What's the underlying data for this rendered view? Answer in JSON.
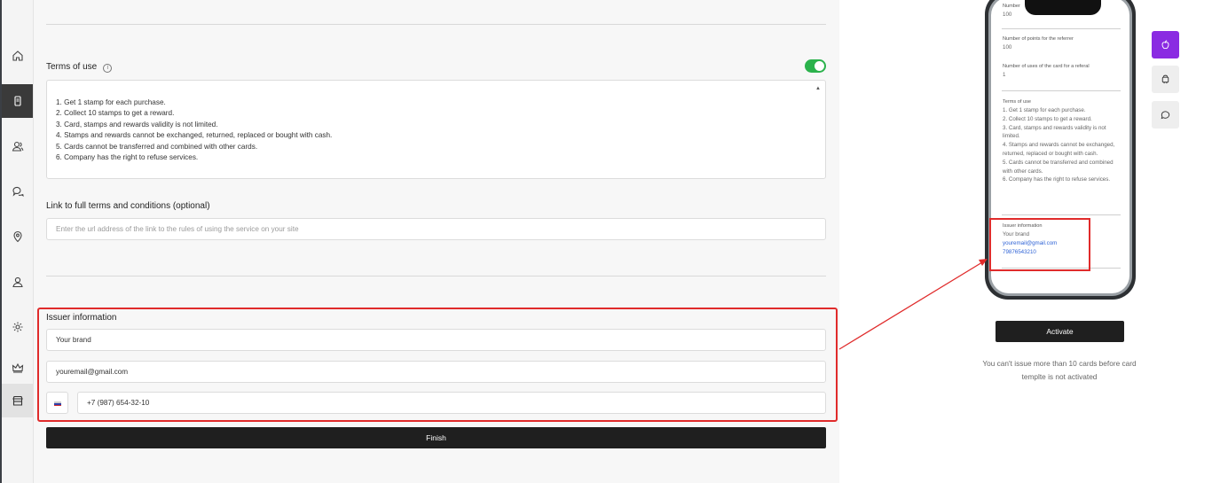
{
  "sidebar": {
    "items": [
      {
        "icon": "home-icon"
      },
      {
        "icon": "card-template-icon",
        "active": true
      },
      {
        "icon": "clients-icon"
      },
      {
        "icon": "messages-icon"
      },
      {
        "icon": "location-icon"
      },
      {
        "icon": "user-icon"
      },
      {
        "icon": "settings-icon"
      },
      {
        "icon": "crown-icon"
      },
      {
        "icon": "store-icon"
      }
    ]
  },
  "form": {
    "terms_label": "Terms of use",
    "terms_enabled": true,
    "terms_text": "1. Get 1 stamp for each purchase.\n2. Collect 10 stamps to get a reward.\n3. Card, stamps and rewards validity is not limited.\n4. Stamps and rewards cannot be exchanged, returned, replaced or bought with cash.\n5. Cards cannot be transferred and combined with other cards.\n6. Company has the right to refuse services.",
    "link_label": "Link to full terms and conditions (optional)",
    "link_placeholder": "Enter the url address of the link to the rules of using the service on your site",
    "issuer_label": "Issuer information",
    "brand_value": "Your brand",
    "email_value": "youremail@gmail.com",
    "phone_value": "+7 (987) 654-32-10",
    "finish_label": "Finish"
  },
  "preview": {
    "phone": {
      "top_label": "Number",
      "top_value": "100",
      "referrer_label": "Number of points for the referrer",
      "referrer_value": "100",
      "uses_label": "Number of uses of the card for a referal",
      "uses_value": "1",
      "terms_title": "Terms of use",
      "terms_text": "1. Get 1 stamp for each purchase.\n2. Collect 10 stamps to get a reward.\n3. Card, stamps and rewards validity is not limited.\n4. Stamps and rewards cannot be exchanged, returned, replaced or bought with cash.\n5. Cards cannot be transferred and combined with other cards.\n6. Company has the right to refuse services.",
      "issuer_title": "Issuer information",
      "issuer_brand": "Your brand",
      "issuer_email": "youremail@gmail.com",
      "issuer_phone": "79876543210"
    },
    "platform_buttons": [
      {
        "icon": "apple-icon",
        "selected": true
      },
      {
        "icon": "android-icon"
      },
      {
        "icon": "chat-icon"
      }
    ],
    "activate_label": "Activate",
    "note": "You can't issue more than 10 cards before card templte is not activated"
  },
  "colors": {
    "accent_green": "#2bb24c",
    "highlight_red": "#e02b2b",
    "purple": "#8a2be2",
    "dark_button": "#1f1f1f"
  }
}
